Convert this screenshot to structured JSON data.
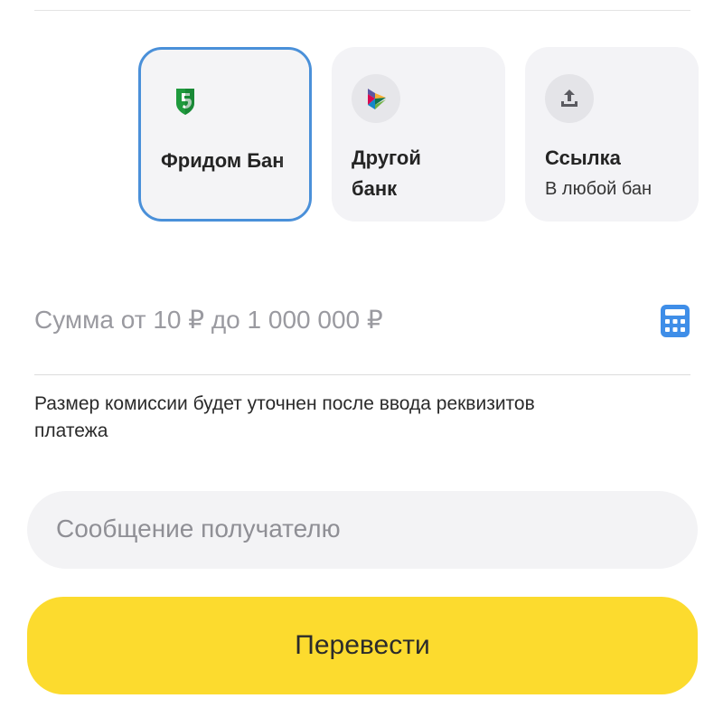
{
  "banks": [
    {
      "name": "Фридом Бан",
      "sub": "",
      "icon": "freedom-bank-logo-icon",
      "selected": true
    },
    {
      "name": "Другой",
      "sub": "банк",
      "icon": "sbp-logo-icon",
      "selected": false
    },
    {
      "name": "Ссылка",
      "sub": "В любой бан",
      "icon": "upload-link-icon",
      "selected": false
    }
  ],
  "amount": {
    "placeholder": "Сумма от 10 ₽ до 1 000 000 ₽",
    "value": "",
    "icon": "calculator-icon"
  },
  "commission_note": "Размер комиссии будет уточнен после ввода реквизитов платежа",
  "message": {
    "placeholder": "Сообщение получателю",
    "value": ""
  },
  "submit_label": "Перевести",
  "colors": {
    "accent": "#fcdb2e",
    "selected_border": "#4a90d9",
    "card_bg": "#f3f3f6"
  }
}
